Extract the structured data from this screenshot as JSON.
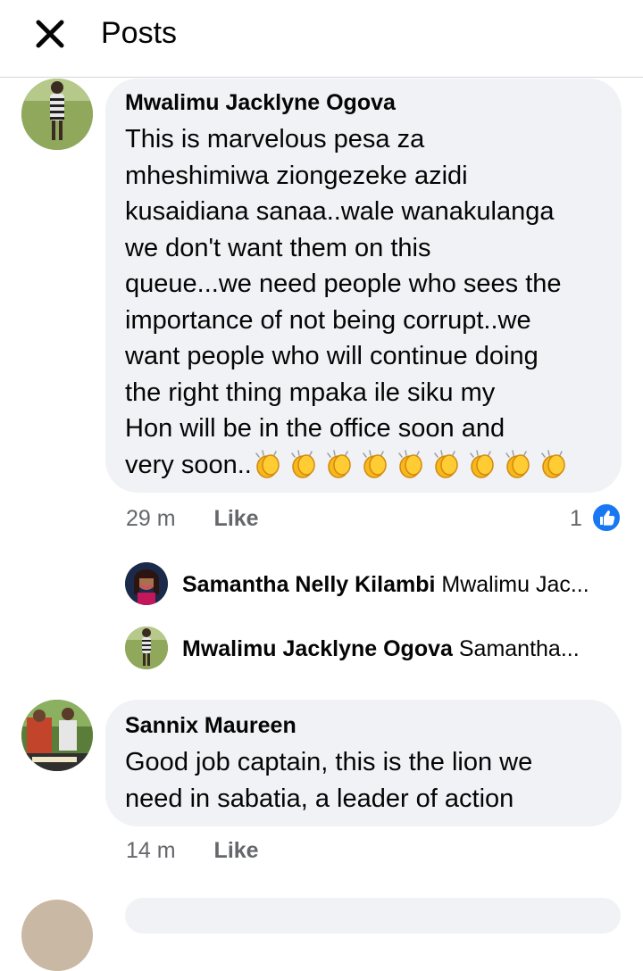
{
  "header": {
    "title": "Posts",
    "close_icon": "close-icon"
  },
  "comments": [
    {
      "author": "Mwalimu Jacklyne Ogova",
      "text": "This is marvelous pesa za\nmheshimiwa ziongezeke azidi\nkusaidiana sanaa..wale wanakulanga\nwe don't want them on this\nqueue...we need people who sees the\nimportance of not being corrupt..we\nwant people who will continue doing\nthe right thing mpaka ile siku  my\nHon will be in the office soon and\nvery soon..",
      "emoji_icon": "clapping-hands-icon",
      "emoji_count": 9,
      "time": "29 m",
      "like_label": "Like",
      "reaction_count": "1",
      "reaction_icon": "thumbs-up-icon",
      "replies": [
        {
          "author": "Samantha Nelly Kilambi",
          "preview": "Mwalimu Jac..."
        },
        {
          "author": "Mwalimu Jacklyne Ogova",
          "preview": "Samantha..."
        }
      ]
    },
    {
      "author": "Sannix Maureen",
      "text": "Good job captain, this is the lion we\nneed in sabatia, a leader of action",
      "time": "14 m",
      "like_label": "Like"
    }
  ],
  "colors": {
    "bubble": "#f0f2f5",
    "meta_text": "#65676b",
    "like_blue": "#1877f2"
  }
}
